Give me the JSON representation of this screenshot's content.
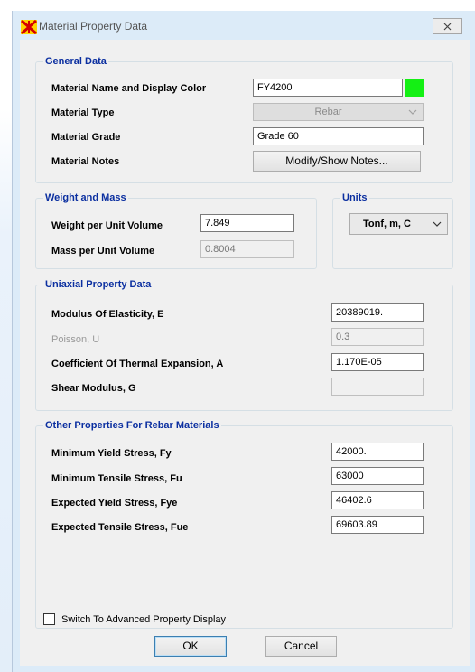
{
  "dialog": {
    "title": "Material Property Data",
    "close_icon": "close-x-icon",
    "app_icon": "etabs-app-icon"
  },
  "general": {
    "section_title": "General Data",
    "name_label": "Material Name and Display Color",
    "name_value": "FY4200",
    "display_color": "#14f014",
    "type_label": "Material Type",
    "type_value": "Rebar",
    "grade_label": "Material Grade",
    "grade_value": "Grade 60",
    "notes_label": "Material Notes",
    "notes_button": "Modify/Show Notes..."
  },
  "weight": {
    "section_title": "Weight and Mass",
    "weight_label": "Weight per Unit Volume",
    "weight_value": "7.849",
    "mass_label": "Mass per Unit Volume",
    "mass_value": "0.8004"
  },
  "units": {
    "section_title": "Units",
    "value": "Tonf, m, C"
  },
  "uniaxial": {
    "section_title": "Uniaxial Property Data",
    "modulus_label": "Modulus Of Elasticity,  E",
    "modulus_value": "20389019.",
    "poisson_label": "Poisson,  U",
    "poisson_value": "0.3",
    "thermal_label": "Coefficient Of Thermal Expansion,  A",
    "thermal_value": "1.170E-05",
    "shear_label": "Shear Modulus,  G",
    "shear_value": ""
  },
  "rebar": {
    "section_title": "Other Properties For Rebar Materials",
    "fy_label": "Minimum Yield Stress, Fy",
    "fy_value": "42000.",
    "fu_label": "Minimum Tensile Stress, Fu",
    "fu_value": "63000",
    "fye_label": "Expected Yield Stress, Fye",
    "fye_value": "46402.6",
    "fue_label": "Expected Tensile Stress, Fue",
    "fue_value": "69603.89"
  },
  "footer": {
    "advanced_label": "Switch To Advanced Property Display",
    "advanced_checked": false,
    "ok_label": "OK",
    "cancel_label": "Cancel"
  }
}
